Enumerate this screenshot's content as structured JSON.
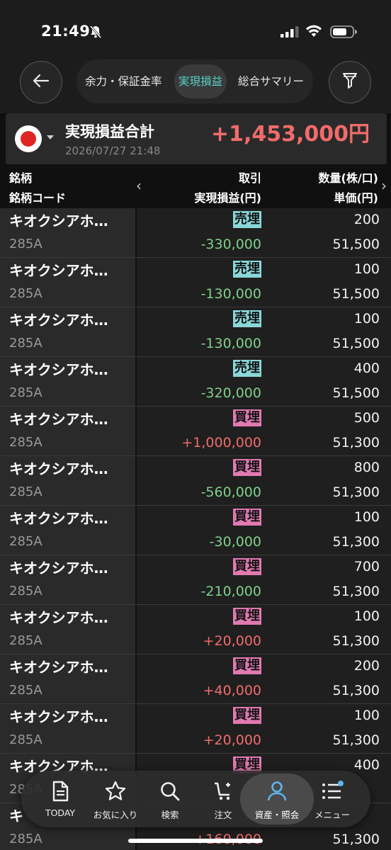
{
  "status_bar": {
    "time": "21:49"
  },
  "nav": {
    "tabs": [
      {
        "label": "余力・保証金率",
        "active": false
      },
      {
        "label": "実現損益",
        "active": true
      },
      {
        "label": "総合サマリー",
        "active": false
      }
    ]
  },
  "summary": {
    "title": "実現損益合計",
    "date": "2026/07/27 21:48",
    "total": "+1,453,000円"
  },
  "columns": {
    "name": "銘柄",
    "code": "銘柄コード",
    "trade": "取引",
    "pl": "実現損益(円)",
    "qty": "数量(株/口)",
    "price": "単価(円)"
  },
  "rows": [
    {
      "name": "キオクシアホ…",
      "code": "285A",
      "trade": "売埋",
      "trade_type": "sell",
      "pl": "-330,000",
      "qty": "200",
      "price": "51,500"
    },
    {
      "name": "キオクシアホ…",
      "code": "285A",
      "trade": "売埋",
      "trade_type": "sell",
      "pl": "-130,000",
      "qty": "100",
      "price": "51,500"
    },
    {
      "name": "キオクシアホ…",
      "code": "285A",
      "trade": "売埋",
      "trade_type": "sell",
      "pl": "-130,000",
      "qty": "100",
      "price": "51,500"
    },
    {
      "name": "キオクシアホ…",
      "code": "285A",
      "trade": "売埋",
      "trade_type": "sell",
      "pl": "-320,000",
      "qty": "400",
      "price": "51,500"
    },
    {
      "name": "キオクシアホ…",
      "code": "285A",
      "trade": "買埋",
      "trade_type": "buy",
      "pl": "+1,000,000",
      "qty": "500",
      "price": "51,300"
    },
    {
      "name": "キオクシアホ…",
      "code": "285A",
      "trade": "買埋",
      "trade_type": "buy",
      "pl": "-560,000",
      "qty": "800",
      "price": "51,300"
    },
    {
      "name": "キオクシアホ…",
      "code": "285A",
      "trade": "買埋",
      "trade_type": "buy",
      "pl": "-30,000",
      "qty": "100",
      "price": "51,300"
    },
    {
      "name": "キオクシアホ…",
      "code": "285A",
      "trade": "買埋",
      "trade_type": "buy",
      "pl": "-210,000",
      "qty": "700",
      "price": "51,300"
    },
    {
      "name": "キオクシアホ…",
      "code": "285A",
      "trade": "買埋",
      "trade_type": "buy",
      "pl": "+20,000",
      "qty": "100",
      "price": "51,300"
    },
    {
      "name": "キオクシアホ…",
      "code": "285A",
      "trade": "買埋",
      "trade_type": "buy",
      "pl": "+40,000",
      "qty": "200",
      "price": "51,300"
    },
    {
      "name": "キオクシアホ…",
      "code": "285A",
      "trade": "買埋",
      "trade_type": "buy",
      "pl": "+20,000",
      "qty": "100",
      "price": "51,300"
    },
    {
      "name": "キオクシアホ…",
      "code": "285A",
      "trade": "買埋",
      "trade_type": "buy",
      "pl": "",
      "qty": "400",
      "price": ""
    },
    {
      "name": "キ",
      "code": "285A",
      "trade": "",
      "trade_type": "buy",
      "pl": "+160,000",
      "qty": "",
      "price": "51,300"
    }
  ],
  "tabbar": {
    "items": [
      {
        "label": "TODAY",
        "icon": "document-icon"
      },
      {
        "label": "お気に入り",
        "icon": "star-icon"
      },
      {
        "label": "検索",
        "icon": "search-icon"
      },
      {
        "label": "注文",
        "icon": "cart-icon"
      },
      {
        "label": "資産・照会",
        "icon": "person-icon",
        "active": true
      },
      {
        "label": "メニュー",
        "icon": "menu-icon"
      }
    ]
  },
  "colors": {
    "positive": "#f26b6b",
    "negative": "#7fd089",
    "sell_badge": "#8ad7d9",
    "buy_badge": "#e07ab1",
    "accent": "#57d3c9"
  }
}
